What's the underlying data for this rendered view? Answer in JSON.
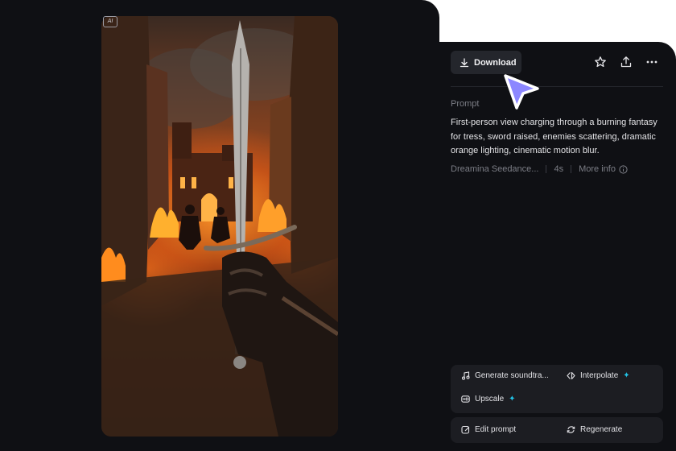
{
  "preview": {
    "badge": "AI",
    "media_description": "video thumbnail"
  },
  "toolbar": {
    "download_label": "Download",
    "icons": [
      "download-icon",
      "star-icon",
      "share-icon",
      "more-icon"
    ]
  },
  "details": {
    "prompt_label": "Prompt",
    "prompt_text": "First-person view charging through a burning fantasy for tress, sword raised, enemies scattering, dramatic orange lighting, cinematic motion blur.",
    "model": "Dreamina Seedance...",
    "duration": "4s",
    "more_info": "More info"
  },
  "actions": {
    "generate_soundtrack": "Generate soundtra...",
    "interpolate": "Interpolate",
    "upscale": "Upscale",
    "edit_prompt": "Edit prompt",
    "regenerate": "Regenerate"
  },
  "colors": {
    "panel_bg": "#0f1014",
    "button_bg": "#24262c",
    "action_bg": "#1c1d22",
    "accent_spark": "#22c3e6",
    "cursor_fill": "#8c87ff"
  }
}
